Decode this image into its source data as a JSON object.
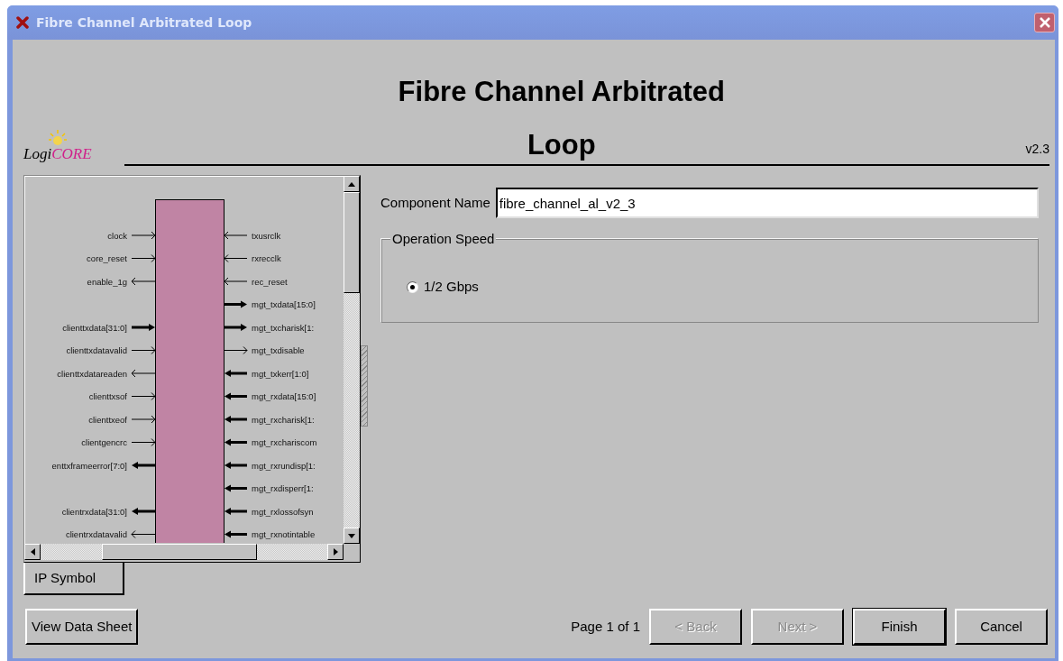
{
  "window": {
    "title": "Fibre Channel Arbitrated Loop"
  },
  "logo": {
    "prefix": "Logi",
    "suffix": "CORE"
  },
  "header": {
    "title": "Fibre Channel Arbitrated Loop",
    "version": "v2.3"
  },
  "symbol": {
    "rows": [
      {
        "left": {
          "name": "clock",
          "input": true,
          "bus": false
        },
        "right": {
          "name": "txusrclk",
          "input": true,
          "bus": false
        }
      },
      {
        "left": {
          "name": "core_reset",
          "input": true,
          "bus": false
        },
        "right": {
          "name": "rxrecclk",
          "input": true,
          "bus": false
        }
      },
      {
        "left": {
          "name": "enable_1g",
          "input": false,
          "bus": false
        },
        "right": {
          "name": "rec_reset",
          "input": true,
          "bus": false
        }
      },
      {
        "right": {
          "name": "mgt_txdata[15:0]",
          "input": false,
          "bus": true
        }
      },
      {
        "left": {
          "name": "clienttxdata[31:0]",
          "input": true,
          "bus": true
        },
        "right": {
          "name": "mgt_txcharisk[1:",
          "input": false,
          "bus": true
        }
      },
      {
        "left": {
          "name": "clienttxdatavalid",
          "input": true,
          "bus": false
        },
        "right": {
          "name": "mgt_txdisable",
          "input": false,
          "bus": false
        }
      },
      {
        "left": {
          "name": "clienttxdatareaden",
          "input": false,
          "bus": false
        },
        "right": {
          "name": "mgt_txkerr[1:0]",
          "input": true,
          "bus": true
        }
      },
      {
        "left": {
          "name": "clienttxsof",
          "input": true,
          "bus": false
        },
        "right": {
          "name": "mgt_rxdata[15:0]",
          "input": true,
          "bus": true
        }
      },
      {
        "left": {
          "name": "clienttxeof",
          "input": true,
          "bus": false
        },
        "right": {
          "name": "mgt_rxcharisk[1:",
          "input": true,
          "bus": true
        }
      },
      {
        "left": {
          "name": "clientgencrc",
          "input": true,
          "bus": false
        },
        "right": {
          "name": "mgt_rxchariscom",
          "input": true,
          "bus": true
        }
      },
      {
        "left": {
          "name": "enttxframeerror[7:0]",
          "input": false,
          "bus": true
        },
        "right": {
          "name": "mgt_rxrundisp[1:",
          "input": true,
          "bus": true
        }
      },
      {
        "right": {
          "name": "mgt_rxdisperr[1:",
          "input": true,
          "bus": true
        }
      },
      {
        "left": {
          "name": "clientrxdata[31:0]",
          "input": false,
          "bus": true
        },
        "right": {
          "name": "mgt_rxlossofsyn",
          "input": true,
          "bus": true
        }
      },
      {
        "left": {
          "name": "clientrxdatavalid",
          "input": false,
          "bus": false
        },
        "right": {
          "name": "mgt_rxnotintable",
          "input": true,
          "bus": true
        }
      }
    ]
  },
  "tabs": [
    {
      "label": "IP Symbol",
      "selected": true
    }
  ],
  "component_name": {
    "label": "Component Name",
    "value": "fibre_channel_al_v2_3"
  },
  "operation_speed": {
    "legend": "Operation Speed",
    "options": [
      {
        "label": "1/2 Gbps",
        "selected": true
      }
    ]
  },
  "data_sheet_button": {
    "label": "View Data Sheet"
  },
  "footer": {
    "page": "Page 1 of 1",
    "buttons": [
      {
        "label": "< Back",
        "disabled": true,
        "default": false
      },
      {
        "label": "Next >",
        "disabled": true,
        "default": false
      },
      {
        "label": "Finish",
        "disabled": false,
        "default": true
      },
      {
        "label": "Cancel",
        "disabled": false,
        "default": false
      }
    ]
  }
}
